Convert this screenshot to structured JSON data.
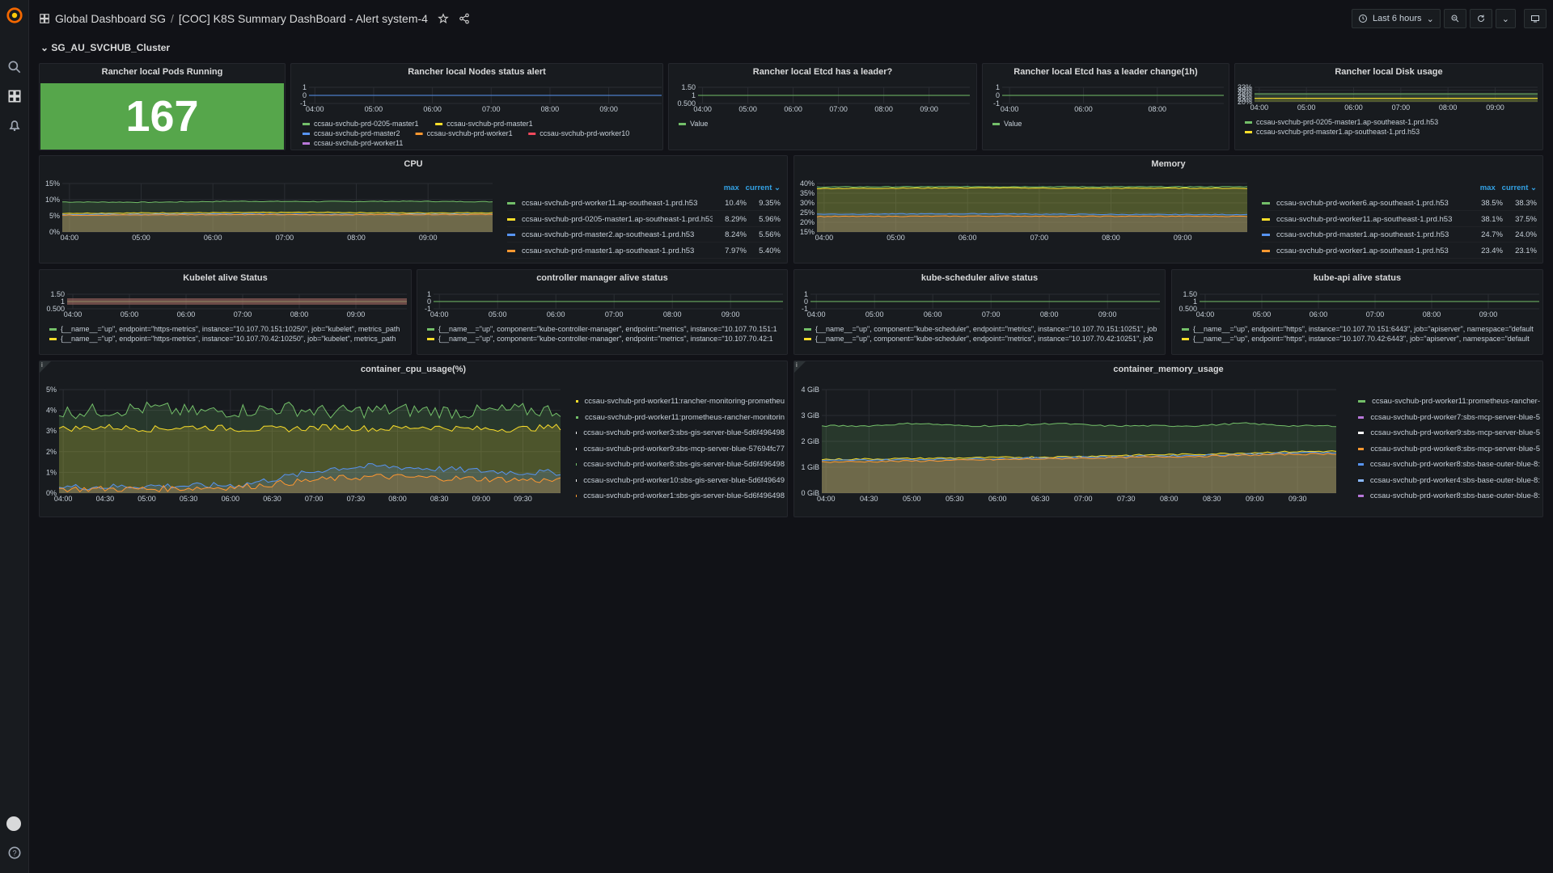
{
  "topbar": {
    "breadcrumb_folder": "Global Dashboard SG",
    "breadcrumb_sep": "/",
    "breadcrumb_title": "[COC] K8S Summary DashBoard - Alert system-4",
    "time_range": "Last 6 hours"
  },
  "row": {
    "title": "SG_AU_SVCHUB_Cluster"
  },
  "icons": {
    "logo": "grafana-logo",
    "search": "search-icon",
    "dashboards": "dashboards-icon",
    "alerting": "bell-icon",
    "profile": "avatar",
    "help": "help-icon",
    "star": "star-icon",
    "share": "share-icon",
    "clock": "clock-icon",
    "zoom_out": "zoom-out-icon",
    "refresh": "refresh-icon",
    "tv": "tv-icon"
  },
  "colors": {
    "stat_green": "#56a64b",
    "green": "#73bf69",
    "yellow": "#fade2a",
    "blue": "#5794f2",
    "cyan": "#8ab8ff",
    "orange": "#ff9830",
    "red": "#f2495c",
    "purple": "#b877d9"
  },
  "panels": {
    "pods": {
      "title": "Rancher local Pods Running",
      "value": "167"
    },
    "nodes": {
      "title": "Rancher local Nodes status alert",
      "yticks": [
        "1",
        "0",
        "-1"
      ],
      "xticks": [
        "04:00",
        "05:00",
        "06:00",
        "07:00",
        "08:00",
        "09:00"
      ],
      "legend": [
        "ccsau-svchub-prd-0205-master1",
        "ccsau-svchub-prd-master1",
        "ccsau-svchub-prd-master2",
        "ccsau-svchub-prd-worker1",
        "ccsau-svchub-prd-worker10",
        "ccsau-svchub-prd-worker11"
      ]
    },
    "etcd_leader": {
      "title": "Rancher local Etcd has a leader?",
      "yticks": [
        "1.50",
        "1",
        "0.500"
      ],
      "xticks": [
        "04:00",
        "05:00",
        "06:00",
        "07:00",
        "08:00",
        "09:00"
      ],
      "legend": [
        "Value"
      ]
    },
    "etcd_change": {
      "title": "Rancher local Etcd has a leader change(1h)",
      "yticks": [
        "1",
        "0",
        "-1"
      ],
      "xticks": [
        "04:00",
        "06:00",
        "08:00"
      ],
      "legend": [
        "Value"
      ]
    },
    "disk": {
      "title": "Rancher local Disk usage",
      "yticks": [
        "33%",
        "30%",
        "28%",
        "25%",
        "23%",
        "20%"
      ],
      "xticks": [
        "04:00",
        "05:00",
        "06:00",
        "07:00",
        "08:00",
        "09:00"
      ],
      "legend": [
        "ccsau-svchub-prd-0205-master1.ap-southeast-1.prd.h53",
        "ccsau-svchub-prd-master1.ap-southeast-1.prd.h53"
      ]
    },
    "cpu": {
      "title": "CPU",
      "yticks": [
        "15%",
        "10%",
        "5%",
        "0%"
      ],
      "xticks": [
        "04:00",
        "05:00",
        "06:00",
        "07:00",
        "08:00",
        "09:00"
      ],
      "col_max": "max",
      "col_current": "current",
      "legend": [
        {
          "name": "ccsau-svchub-prd-worker11.ap-southeast-1.prd.h53",
          "max": "10.4%",
          "current": "9.35%"
        },
        {
          "name": "ccsau-svchub-prd-0205-master1.ap-southeast-1.prd.h53",
          "max": "8.29%",
          "current": "5.96%"
        },
        {
          "name": "ccsau-svchub-prd-master2.ap-southeast-1.prd.h53",
          "max": "8.24%",
          "current": "5.56%"
        },
        {
          "name": "ccsau-svchub-prd-master1.ap-southeast-1.prd.h53",
          "max": "7.97%",
          "current": "5.40%"
        }
      ]
    },
    "memory": {
      "title": "Memory",
      "yticks": [
        "40%",
        "35%",
        "30%",
        "25%",
        "20%",
        "15%"
      ],
      "xticks": [
        "04:00",
        "05:00",
        "06:00",
        "07:00",
        "08:00",
        "09:00"
      ],
      "col_max": "max",
      "col_current": "current",
      "legend": [
        {
          "name": "ccsau-svchub-prd-worker6.ap-southeast-1.prd.h53",
          "max": "38.5%",
          "current": "38.3%"
        },
        {
          "name": "ccsau-svchub-prd-worker11.ap-southeast-1.prd.h53",
          "max": "38.1%",
          "current": "37.5%"
        },
        {
          "name": "ccsau-svchub-prd-master1.ap-southeast-1.prd.h53",
          "max": "24.7%",
          "current": "24.0%"
        },
        {
          "name": "ccsau-svchub-prd-worker1.ap-southeast-1.prd.h53",
          "max": "23.4%",
          "current": "23.1%"
        }
      ]
    },
    "kubelet": {
      "title": "Kubelet alive Status",
      "yticks": [
        "1.50",
        "1",
        "0.500"
      ],
      "xticks": [
        "04:00",
        "05:00",
        "06:00",
        "07:00",
        "08:00",
        "09:00"
      ],
      "legend": [
        "{__name__=\"up\", endpoint=\"https-metrics\", instance=\"10.107.70.151:10250\", job=\"kubelet\", metrics_path",
        "{__name__=\"up\", endpoint=\"https-metrics\", instance=\"10.107.70.42:10250\", job=\"kubelet\", metrics_path"
      ]
    },
    "controller": {
      "title": "controller manager alive status",
      "yticks": [
        "1",
        "0",
        "-1"
      ],
      "xticks": [
        "04:00",
        "05:00",
        "06:00",
        "07:00",
        "08:00",
        "09:00"
      ],
      "legend": [
        "{__name__=\"up\", component=\"kube-controller-manager\", endpoint=\"metrics\", instance=\"10.107.70.151:1",
        "{__name__=\"up\", component=\"kube-controller-manager\", endpoint=\"metrics\", instance=\"10.107.70.42:1"
      ]
    },
    "scheduler": {
      "title": "kube-scheduler alive status",
      "yticks": [
        "1",
        "0",
        "-1"
      ],
      "xticks": [
        "04:00",
        "05:00",
        "06:00",
        "07:00",
        "08:00",
        "09:00"
      ],
      "legend": [
        "{__name__=\"up\", component=\"kube-scheduler\", endpoint=\"metrics\", instance=\"10.107.70.151:10251\", job",
        "{__name__=\"up\", component=\"kube-scheduler\", endpoint=\"metrics\", instance=\"10.107.70.42:10251\", job"
      ]
    },
    "apiserver": {
      "title": "kube-api alive status",
      "yticks": [
        "1.50",
        "1",
        "0.500"
      ],
      "xticks": [
        "04:00",
        "05:00",
        "06:00",
        "07:00",
        "08:00",
        "09:00"
      ],
      "legend": [
        "{__name__=\"up\", endpoint=\"https\", instance=\"10.107.70.151:6443\", job=\"apiserver\", namespace=\"default",
        "{__name__=\"up\", endpoint=\"https\", instance=\"10.107.70.42:6443\", job=\"apiserver\", namespace=\"default"
      ]
    },
    "container_cpu": {
      "title": "container_cpu_usage(%)",
      "info": "i",
      "yticks": [
        "5%",
        "4%",
        "3%",
        "2%",
        "1%",
        "0%"
      ],
      "xticks": [
        "04:00",
        "04:30",
        "05:00",
        "05:30",
        "06:00",
        "06:30",
        "07:00",
        "07:30",
        "08:00",
        "08:30",
        "09:00",
        "09:30"
      ],
      "legend": [
        "ccsau-svchub-prd-worker11:rancher-monitoring-prometheu",
        "ccsau-svchub-prd-worker11:prometheus-rancher-monitorin",
        "ccsau-svchub-prd-worker3:sbs-gis-server-blue-5d6f496498",
        "ccsau-svchub-prd-worker9:sbs-mcp-server-blue-57694fc77",
        "ccsau-svchub-prd-worker8:sbs-gis-server-blue-5d6f496498",
        "ccsau-svchub-prd-worker10:sbs-gis-server-blue-5d6f49649",
        "ccsau-svchub-prd-worker1:sbs-gis-server-blue-5d6f496498"
      ]
    },
    "container_mem": {
      "title": "container_memory_usage",
      "info": "i",
      "yticks": [
        "4 GiB",
        "3 GiB",
        "2 GiB",
        "1 GiB",
        "0 GiB"
      ],
      "xticks": [
        "04:00",
        "04:30",
        "05:00",
        "05:30",
        "06:00",
        "06:30",
        "07:00",
        "07:30",
        "08:00",
        "08:30",
        "09:00",
        "09:30"
      ],
      "legend": [
        "ccsau-svchub-prd-worker11:prometheus-rancher-",
        "ccsau-svchub-prd-worker7:sbs-mcp-server-blue-5",
        "ccsau-svchub-prd-worker9:sbs-mcp-server-blue-5",
        "ccsau-svchub-prd-worker8:sbs-mcp-server-blue-5",
        "ccsau-svchub-prd-worker8:sbs-base-outer-blue-8:",
        "ccsau-svchub-prd-worker4:sbs-base-outer-blue-8:",
        "ccsau-svchub-prd-worker8:sbs-base-outer-blue-8:"
      ]
    }
  },
  "chart_data": [
    {
      "type": "line",
      "title": "Rancher local Nodes status alert",
      "x": [
        "04:00",
        "05:00",
        "06:00",
        "07:00",
        "08:00",
        "09:00"
      ],
      "ylim": [
        -1,
        1
      ],
      "series": [
        {
          "name": "ccsau-svchub-prd-0205-master1",
          "values": [
            0,
            0,
            0,
            0,
            0,
            0
          ]
        },
        {
          "name": "ccsau-svchub-prd-master1",
          "values": [
            0,
            0,
            0,
            0,
            0,
            0
          ]
        },
        {
          "name": "ccsau-svchub-prd-master2",
          "values": [
            0,
            0,
            0,
            0,
            0,
            0
          ]
        }
      ]
    },
    {
      "type": "line",
      "title": "Rancher local Etcd has a leader?",
      "x": [
        "04:00",
        "05:00",
        "06:00",
        "07:00",
        "08:00",
        "09:00"
      ],
      "ylim": [
        0.5,
        1.5
      ],
      "series": [
        {
          "name": "Value",
          "values": [
            1,
            1,
            1,
            1,
            1,
            1
          ]
        }
      ]
    },
    {
      "type": "line",
      "title": "Rancher local Etcd has a leader change(1h)",
      "x": [
        "04:00",
        "06:00",
        "08:00"
      ],
      "ylim": [
        -1,
        1
      ],
      "series": [
        {
          "name": "Value",
          "values": [
            0,
            0,
            0
          ]
        }
      ]
    },
    {
      "type": "area",
      "title": "Rancher local Disk usage",
      "x": [
        "04:00",
        "05:00",
        "06:00",
        "07:00",
        "08:00",
        "09:00"
      ],
      "series": [
        {
          "name": "ccsau-svchub-prd-0205-master1.ap-southeast-1.prd.h53",
          "values": [
            30,
            30,
            30,
            30,
            30,
            30
          ]
        },
        {
          "name": "ccsau-svchub-prd-master1.ap-southeast-1.prd.h53",
          "values": [
            28,
            28,
            28,
            28,
            28,
            28
          ]
        }
      ]
    },
    {
      "type": "area",
      "title": "CPU",
      "x": [
        "04:00",
        "05:00",
        "06:00",
        "07:00",
        "08:00",
        "09:00"
      ],
      "ylim": [
        0,
        15
      ],
      "series": [
        {
          "name": "ccsau-svchub-prd-worker11.ap-southeast-1.prd.h53",
          "values": [
            9.3,
            9.2,
            9.5,
            9.4,
            9.5,
            9.35
          ]
        },
        {
          "name": "ccsau-svchub-prd-0205-master1.ap-southeast-1.prd.h53",
          "values": [
            5.8,
            5.9,
            6.0,
            6.1,
            5.9,
            5.96
          ]
        },
        {
          "name": "ccsau-svchub-prd-master2.ap-southeast-1.prd.h53",
          "values": [
            5.4,
            5.5,
            5.6,
            5.5,
            5.5,
            5.56
          ]
        },
        {
          "name": "ccsau-svchub-prd-master1.ap-southeast-1.prd.h53",
          "values": [
            5.2,
            5.3,
            5.4,
            5.3,
            5.4,
            5.4
          ]
        }
      ]
    },
    {
      "type": "area",
      "title": "Memory",
      "x": [
        "04:00",
        "05:00",
        "06:00",
        "07:00",
        "08:00",
        "09:00"
      ],
      "ylim": [
        15,
        40
      ],
      "series": [
        {
          "name": "ccsau-svchub-prd-worker6.ap-southeast-1.prd.h53",
          "values": [
            38.2,
            38.3,
            38.4,
            38.3,
            38.3,
            38.3
          ]
        },
        {
          "name": "ccsau-svchub-prd-worker11.ap-southeast-1.prd.h53",
          "values": [
            37.4,
            37.6,
            37.8,
            37.5,
            37.6,
            37.5
          ]
        },
        {
          "name": "ccsau-svchub-prd-master1.ap-southeast-1.prd.h53",
          "values": [
            24.2,
            24.3,
            24.4,
            24.1,
            24.0,
            24.0
          ]
        },
        {
          "name": "ccsau-svchub-prd-worker1.ap-southeast-1.prd.h53",
          "values": [
            23.0,
            23.1,
            23.2,
            23.1,
            23.1,
            23.1
          ]
        }
      ]
    },
    {
      "type": "line",
      "title": "Kubelet alive Status",
      "x": [
        "04:00",
        "05:00",
        "06:00",
        "07:00",
        "08:00",
        "09:00"
      ],
      "ylim": [
        0.5,
        1.5
      ],
      "series": [
        {
          "values": [
            1,
            1,
            1,
            1,
            1,
            1
          ]
        }
      ]
    },
    {
      "type": "line",
      "title": "controller manager alive status",
      "x": [
        "04:00",
        "05:00",
        "06:00",
        "07:00",
        "08:00",
        "09:00"
      ],
      "ylim": [
        -1,
        1
      ],
      "series": [
        {
          "values": [
            0,
            0,
            0,
            0,
            0,
            0
          ]
        }
      ]
    },
    {
      "type": "line",
      "title": "kube-scheduler alive status",
      "x": [
        "04:00",
        "05:00",
        "06:00",
        "07:00",
        "08:00",
        "09:00"
      ],
      "ylim": [
        -1,
        1
      ],
      "series": [
        {
          "values": [
            0,
            0,
            0,
            0,
            0,
            0
          ]
        }
      ]
    },
    {
      "type": "line",
      "title": "kube-api alive status",
      "x": [
        "04:00",
        "05:00",
        "06:00",
        "07:00",
        "08:00",
        "09:00"
      ],
      "ylim": [
        0.5,
        1.5
      ],
      "series": [
        {
          "values": [
            1,
            1,
            1,
            1,
            1,
            1
          ]
        }
      ]
    },
    {
      "type": "area",
      "title": "container_cpu_usage(%)",
      "x": [
        "04:00",
        "04:30",
        "05:00",
        "05:30",
        "06:00",
        "06:30",
        "07:00",
        "07:30",
        "08:00",
        "08:30",
        "09:00",
        "09:30"
      ],
      "ylim": [
        0,
        5
      ],
      "series": [
        {
          "name": "ccsau-svchub-prd-worker11:rancher-monitoring-prometheu",
          "values": [
            3.9,
            4.0,
            4.1,
            3.9,
            4.0,
            4.1,
            3.9,
            4.0,
            4.0,
            3.9,
            4.0,
            4.0
          ]
        },
        {
          "name": "ccsau-svchub-prd-worker11:prometheus-rancher-monitorin",
          "values": [
            3.1,
            3.2,
            3.1,
            3.2,
            3.1,
            3.1,
            3.2,
            3.1,
            3.2,
            3.1,
            3.1,
            3.2
          ]
        },
        {
          "name": "ccsau-svchub-prd-worker3:sbs-gis-server-blue-5d6f496498",
          "values": [
            0.3,
            0.3,
            0.35,
            0.35,
            0.4,
            0.8,
            1.2,
            1.3,
            1.2,
            1.1,
            1.0,
            1.0
          ]
        },
        {
          "name": "ccsau-svchub-prd-worker9:sbs-mcp-server-blue-57694fc77",
          "values": [
            0.2,
            0.2,
            0.2,
            0.25,
            0.3,
            0.5,
            0.7,
            0.8,
            0.75,
            0.7,
            0.65,
            0.6
          ]
        }
      ]
    },
    {
      "type": "area",
      "title": "container_memory_usage",
      "x": [
        "04:00",
        "04:30",
        "05:00",
        "05:30",
        "06:00",
        "06:30",
        "07:00",
        "07:30",
        "08:00",
        "08:30",
        "09:00",
        "09:30"
      ],
      "ylim": [
        0,
        4
      ],
      "series": [
        {
          "name": "ccsau-svchub-prd-worker11:prometheus-rancher-",
          "values": [
            2.6,
            2.6,
            2.7,
            2.6,
            2.6,
            2.7,
            2.6,
            2.6,
            2.6,
            2.7,
            2.6,
            2.6
          ]
        },
        {
          "name": "ccsau-svchub-prd-worker7:sbs-mcp-server-blue-5",
          "values": [
            1.3,
            1.32,
            1.34,
            1.36,
            1.38,
            1.4,
            1.44,
            1.48,
            1.5,
            1.55,
            1.6,
            1.62
          ]
        },
        {
          "name": "ccsau-svchub-prd-worker9:sbs-mcp-server-blue-5",
          "values": [
            1.25,
            1.28,
            1.3,
            1.32,
            1.34,
            1.37,
            1.4,
            1.43,
            1.46,
            1.5,
            1.55,
            1.58
          ]
        },
        {
          "name": "ccsau-svchub-prd-worker8:sbs-mcp-server-blue-5",
          "values": [
            1.2,
            1.22,
            1.24,
            1.27,
            1.3,
            1.33,
            1.36,
            1.39,
            1.42,
            1.46,
            1.5,
            1.52
          ]
        }
      ]
    }
  ]
}
